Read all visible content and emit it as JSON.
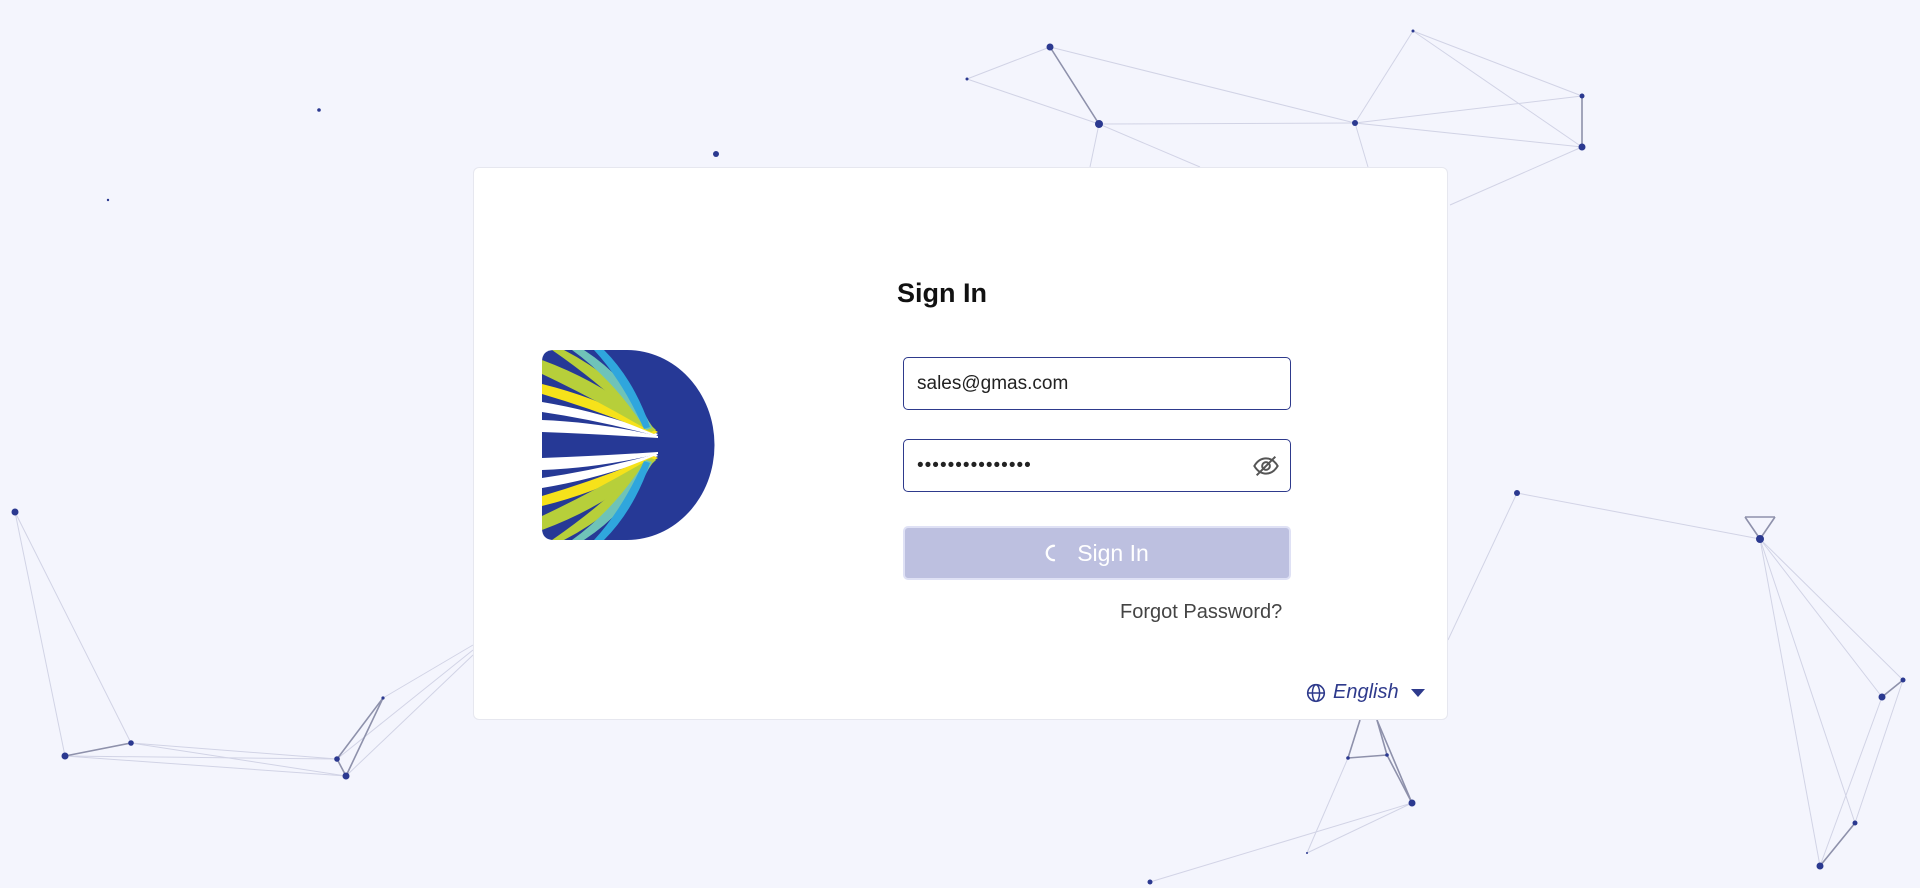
{
  "login": {
    "title": "Sign In",
    "email_value": "sales@gmas.com",
    "password_value": "•••••••••••••••",
    "submit_label": "Sign In",
    "forgot_label": "Forgot Password?",
    "language_label": "English"
  },
  "icons": {
    "logo": "brand-logo",
    "password_toggle": "eye-off-icon",
    "spinner": "loading-spinner-icon",
    "language": "globe-icon",
    "dropdown": "caret-down-icon"
  },
  "colors": {
    "background": "#f4f5fd",
    "primary": "#2e3a8c",
    "button_disabled": "#bdc0e0",
    "logo_blue": "#263996"
  }
}
